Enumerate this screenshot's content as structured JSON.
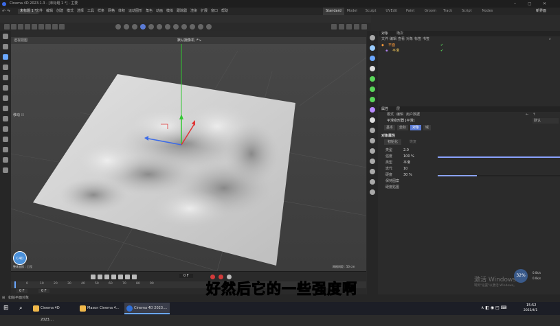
{
  "window": {
    "title": "Cinema 4D 2023.1.3 - [未标题 1 *] - 主要"
  },
  "menu": [
    "文件",
    "编辑",
    "创建",
    "模式",
    "选择",
    "工具",
    "样条",
    "网格",
    "体积",
    "运动图形",
    "角色",
    "动画",
    "模拟",
    "跟踪器",
    "渲染",
    "扩展",
    "窗口",
    "帮助"
  ],
  "workspaces": [
    "Standard",
    "Model",
    "Sculpt",
    "UVEdit",
    "Paint",
    "Groom",
    "Track",
    "Script",
    "Nodes"
  ],
  "workspace_active": "Standard",
  "new_interface": "新界面",
  "doc_tab": "未标题 1 *",
  "viewport": {
    "name": "透视视图",
    "camera": "默认摄像机 :*↘",
    "grid_info": "网格间距 : 50 cm",
    "mode_label": "移动 ⁝⁝⁝",
    "corner_label": "整体变换 : 工程"
  },
  "object_manager": {
    "tabs": [
      "对象",
      "场次"
    ],
    "menu": [
      "文件",
      "编辑",
      "查看",
      "对象",
      "标签",
      "书签"
    ],
    "items": [
      {
        "name": "平面",
        "tag": "●"
      },
      {
        "name": "平滑",
        "tag": ""
      }
    ]
  },
  "attributes": {
    "tabs": [
      "属性",
      "层"
    ],
    "menu": [
      "模式",
      "编辑",
      "用户数据"
    ],
    "object_title": "平滑变形器 [平滑]",
    "default_label": "默认",
    "subtabs": [
      "基本",
      "坐标",
      "对象",
      "域"
    ],
    "active_subtab": "对象",
    "section_title": "对象属性",
    "init_button": "初始化",
    "reset_button": "恢复",
    "rows": [
      {
        "label": "类型",
        "value": "2.0"
      },
      {
        "label": "强度",
        "value": "100 %",
        "fill": 1.0
      },
      {
        "label": "类型",
        "value": "平滑"
      },
      {
        "label": "迭代",
        "value": "10"
      },
      {
        "label": "硬度",
        "value": "30 %",
        "fill": 0.3
      },
      {
        "label": "保持图案",
        "value": ""
      },
      {
        "label": "硬度贴图",
        "value": ""
      }
    ]
  },
  "timeline": {
    "frame_current": "0 F",
    "frame_end": "0 F",
    "ticks": [
      "0",
      "10",
      "20",
      "30",
      "40",
      "50",
      "60",
      "70",
      "80",
      "90"
    ],
    "start_field": "0 F",
    "end_field": "0 F"
  },
  "statusbar": {
    "text": "移动: 点击并拖动鼠标移动元素。按住 SHIFT 键量化移动; 节点编辑模式时按住 SHIFT 键增加选择对象; 按住 CTRL 键减少选择对象。",
    "left": "如始平面对象"
  },
  "subtitle": "好然后它的一些强度啊",
  "watermark": {
    "line1": "激活 Windows",
    "line2": "转到\"设置\"以激活 Windows。"
  },
  "taskbar": {
    "items": [
      "Cinema 4D 2023....",
      "Maxon Cinema 4...",
      "Cinema 4D 2023...."
    ],
    "clock": "15:52",
    "date": "2023/4/1",
    "percent": "32%",
    "net": "0.0k/s",
    "net2": "0.0k/s"
  },
  "colors": {
    "accent": "#6ba8ff",
    "y_axis": "#32c832",
    "x_axis": "#e03434",
    "z_axis": "#3b6be8"
  }
}
